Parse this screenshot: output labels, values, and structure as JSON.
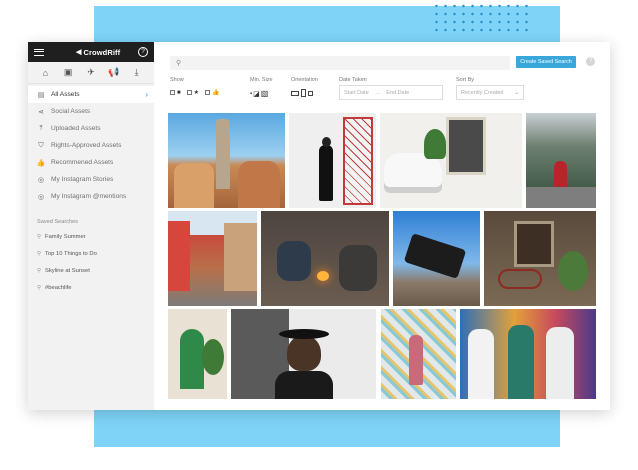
{
  "brand": {
    "logo_text": "CrowdRiff",
    "help": "?"
  },
  "sidebar": {
    "nav_items": [
      {
        "label": "All Assets",
        "icon": "image-stack-icon",
        "active": true
      },
      {
        "label": "Social Assets",
        "icon": "share-icon"
      },
      {
        "label": "Uploaded Assets",
        "icon": "upload-icon"
      },
      {
        "label": "Rights-Approved Assets",
        "icon": "shield-icon"
      },
      {
        "label": "Recommened Assets",
        "icon": "thumbs-up-icon"
      },
      {
        "label": "My Instagram Stories",
        "icon": "instagram-icon"
      },
      {
        "label": "My Instagram @mentions",
        "icon": "instagram-icon"
      }
    ],
    "saved_heading": "Saved Searches",
    "saved_items": [
      {
        "label": "Family Summer"
      },
      {
        "label": "Top 10 Things to Do"
      },
      {
        "label": "Skyline at Sunset"
      },
      {
        "label": "#beachlife"
      }
    ]
  },
  "toolbar": {
    "search_placeholder": "",
    "create_button": "Create Saved Search",
    "help": "?"
  },
  "filters": {
    "show_label": "Show",
    "minsize_label": "Min. Size",
    "orientation_label": "Orientation",
    "date_label": "Date Taken",
    "start_date": "Start Date",
    "arrow": "→",
    "end_date": "End Date",
    "sort_label": "Sort By",
    "sort_value": "Recently Created"
  },
  "colors": {
    "accent": "#3aa7db",
    "sidebar_bg": "#f2f2f2",
    "topbar_bg": "#1f1f1f",
    "decor_bg": "#7ed3f7"
  },
  "photos": [
    {
      "name": "park-guell-photo"
    },
    {
      "name": "woman-red-door-photo"
    },
    {
      "name": "white-car-photo"
    },
    {
      "name": "woman-bridge-forest-photo"
    },
    {
      "name": "colorful-street-photo"
    },
    {
      "name": "campfire-friends-photo"
    },
    {
      "name": "jeep-offroad-photo"
    },
    {
      "name": "bicycle-facade-photo"
    },
    {
      "name": "green-door-photo"
    },
    {
      "name": "man-hat-portrait-photo"
    },
    {
      "name": "woman-mural-photo"
    },
    {
      "name": "friends-graffiti-photo"
    }
  ]
}
